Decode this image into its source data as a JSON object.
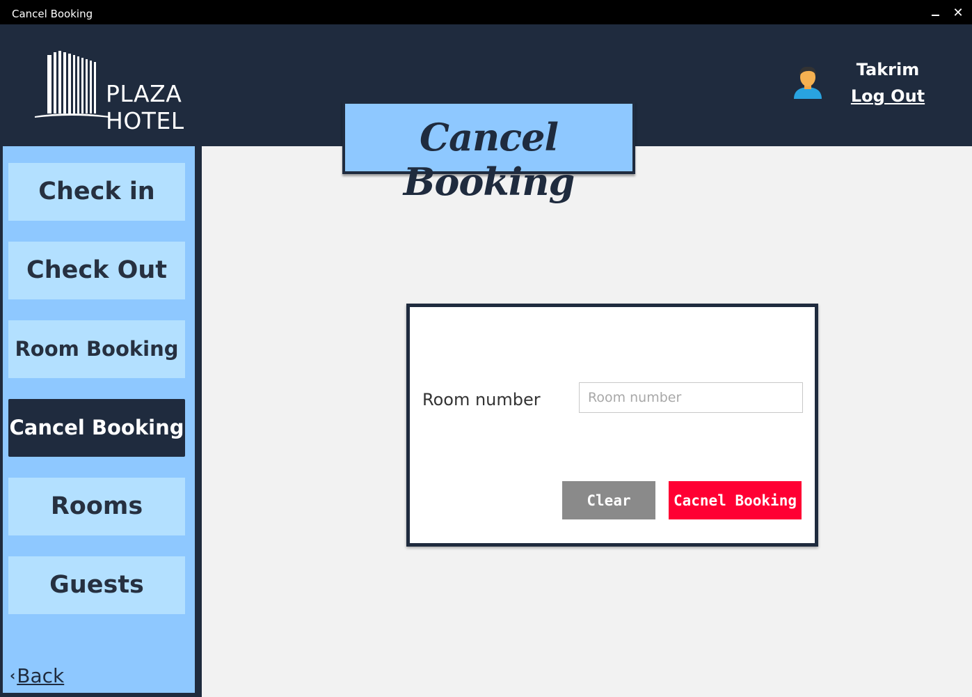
{
  "window": {
    "title": "Cancel Booking",
    "minimize_icon": "minimize-icon",
    "close_icon": "close-icon",
    "close_glyph": "✕"
  },
  "header": {
    "logo_text": "PLAZA HOTEL",
    "logo_icon": "hotel-building-icon",
    "user_icon": "user-avatar-icon",
    "username": "Takrim",
    "logout_label": "Log Out",
    "page_title": "Cancel Booking"
  },
  "sidebar": {
    "items": [
      {
        "label": "Check in",
        "active": false
      },
      {
        "label": "Check Out",
        "active": false
      },
      {
        "label": "Room Booking",
        "active": false
      },
      {
        "label": "Cancel Booking",
        "active": true
      },
      {
        "label": "Rooms",
        "active": false
      },
      {
        "label": "Guests",
        "active": false
      }
    ],
    "back_icon": "chevron-left-icon",
    "back_glyph": "‹",
    "back_label": "Back"
  },
  "form": {
    "room_label": "Room number",
    "room_value": "",
    "room_placeholder": "Room number",
    "clear_label": "Clear",
    "submit_label": "Cacnel Booking"
  },
  "colors": {
    "header_bg": "#1f2b3e",
    "accent_light": "#8ec8ff",
    "nav_button": "#b3e0ff",
    "danger": "#ff0033",
    "neutral_button": "#8a8a8a"
  }
}
